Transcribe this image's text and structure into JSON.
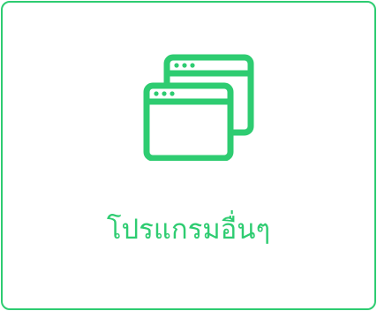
{
  "card": {
    "label": "โปรแกรมอื่นๆ",
    "icon": "windows-icon",
    "accent_color": "#2ecc71"
  }
}
